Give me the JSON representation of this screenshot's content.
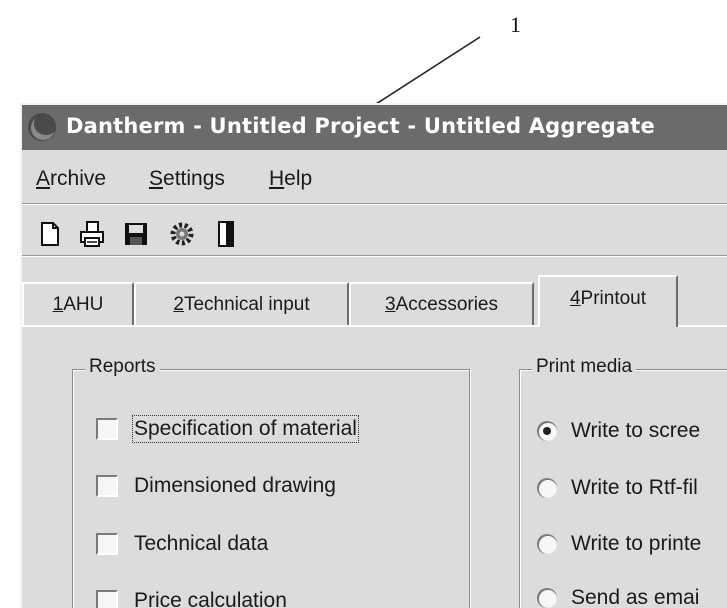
{
  "annotation": {
    "callout_number": "1"
  },
  "window": {
    "title": "Dantherm - Untitled Project - Untitled Aggregate",
    "app_icon": "dantherm-logo-icon"
  },
  "menu": {
    "items": [
      {
        "mnemonic": "A",
        "rest": "rchive"
      },
      {
        "mnemonic": "S",
        "rest": "ettings"
      },
      {
        "mnemonic": "H",
        "rest": "elp"
      }
    ]
  },
  "toolbar": {
    "icons": [
      "new-document-icon",
      "print-icon",
      "save-icon",
      "settings-gear-icon",
      "exit-door-icon"
    ]
  },
  "tabs": [
    {
      "mnemonic": "1",
      "rest": " AHU",
      "active": false
    },
    {
      "mnemonic": "2",
      "rest": " Technical input",
      "active": false
    },
    {
      "mnemonic": "3",
      "rest": " Accessories",
      "active": false
    },
    {
      "mnemonic": "4",
      "rest": " Printout",
      "active": true
    }
  ],
  "reports": {
    "title": "Reports",
    "items": [
      {
        "label": "Specification of material",
        "checked": false,
        "focused": true
      },
      {
        "label": "Dimensioned drawing",
        "checked": false,
        "focused": false
      },
      {
        "label": "Technical data",
        "checked": false,
        "focused": false
      },
      {
        "label": "Price calculation",
        "checked": false,
        "focused": false
      }
    ]
  },
  "print_media": {
    "title": "Print media",
    "options": [
      {
        "label": "Write to scree",
        "selected": true
      },
      {
        "label": "Write to Rtf-fil",
        "selected": false
      },
      {
        "label": "Write to printe",
        "selected": false
      },
      {
        "label": "Send as emai",
        "selected": false
      }
    ]
  }
}
